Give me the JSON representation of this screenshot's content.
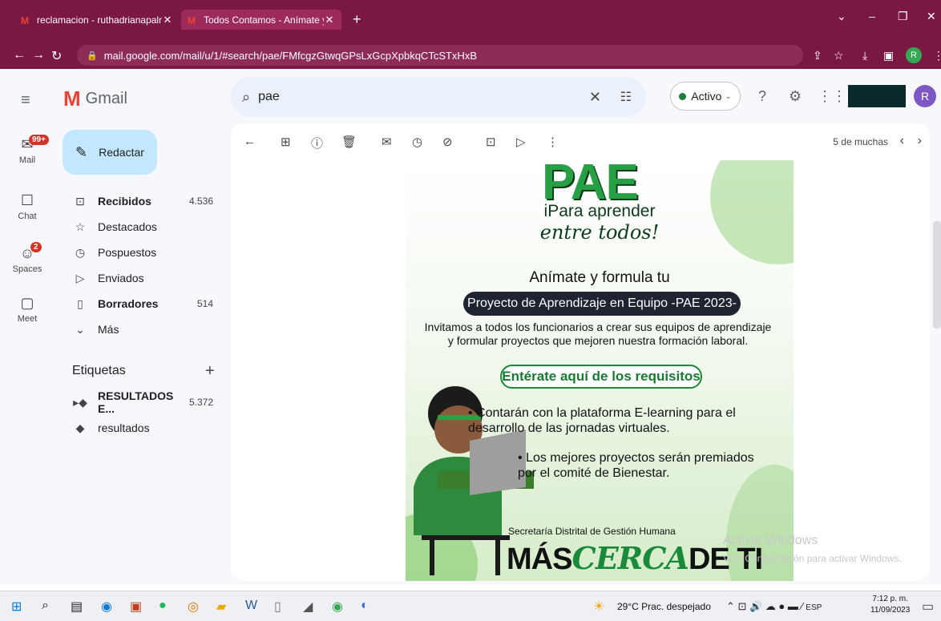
{
  "browser": {
    "tabs": [
      {
        "label": "reclamacion - ruthadrianapalmet",
        "active": false
      },
      {
        "label": "Todos Contamos - Anímate y",
        "active": true
      }
    ],
    "url": "mail.google.com/mail/u/1/#search/pae/FMfcgzGtwqGPsLxGcpXpbkqCTcSTxHxB",
    "profile_initial": "R"
  },
  "gmail": {
    "logo_text": "Gmail",
    "search": {
      "value": "pae"
    },
    "status": "Activo",
    "avatar_initial": "R",
    "rail": [
      {
        "label": "Mail",
        "badge": "99+"
      },
      {
        "label": "Chat"
      },
      {
        "label": "Spaces",
        "badge": "2"
      },
      {
        "label": "Meet"
      }
    ],
    "compose_label": "Redactar",
    "folders": [
      {
        "label": "Recibidos",
        "count": "4.536",
        "bold": true
      },
      {
        "label": "Destacados",
        "count": ""
      },
      {
        "label": "Pospuestos",
        "count": ""
      },
      {
        "label": "Enviados",
        "count": ""
      },
      {
        "label": "Borradores",
        "count": "514",
        "bold": true
      },
      {
        "label": "Más",
        "count": ""
      }
    ],
    "labels_title": "Etiquetas",
    "labels": [
      {
        "label": "RESULTADOS E...",
        "count": "5.372"
      },
      {
        "label": "resultados",
        "count": ""
      }
    ],
    "pager": "5 de muchas"
  },
  "poster": {
    "logo": "PAE",
    "tag1": "iPara aprender",
    "tag2": "entre todos!",
    "animate": "Anímate y formula tu",
    "banner": "Proyecto de Aprendizaje en Equipo -PAE 2023-",
    "invite": "Invitamos a todos los funcionarios a crear sus equipos de aprendizaje y formular proyectos que mejoren nuestra formación laboral.",
    "requirements": "Entérate aquí de los requisitos",
    "bullet1": "• Contarán con la plataforma E-learning para el desarrollo de las jornadas virtuales.",
    "bullet2": "• Los mejores proyectos serán premiados por el comité de Bienestar.",
    "secretaria": "Secretaría Distrital de Gestión Humana",
    "mas": "MÁS",
    "cerca": "CERCA",
    "deti": "DE TI"
  },
  "watermark": {
    "line1": "Activar Windows",
    "line2": "Ve a Configuración para activar Windows."
  },
  "taskbar": {
    "weather": "29°C  Prac. despejado",
    "lang": "ESP",
    "time": "7:12 p. m.",
    "date": "11/09/2023"
  }
}
